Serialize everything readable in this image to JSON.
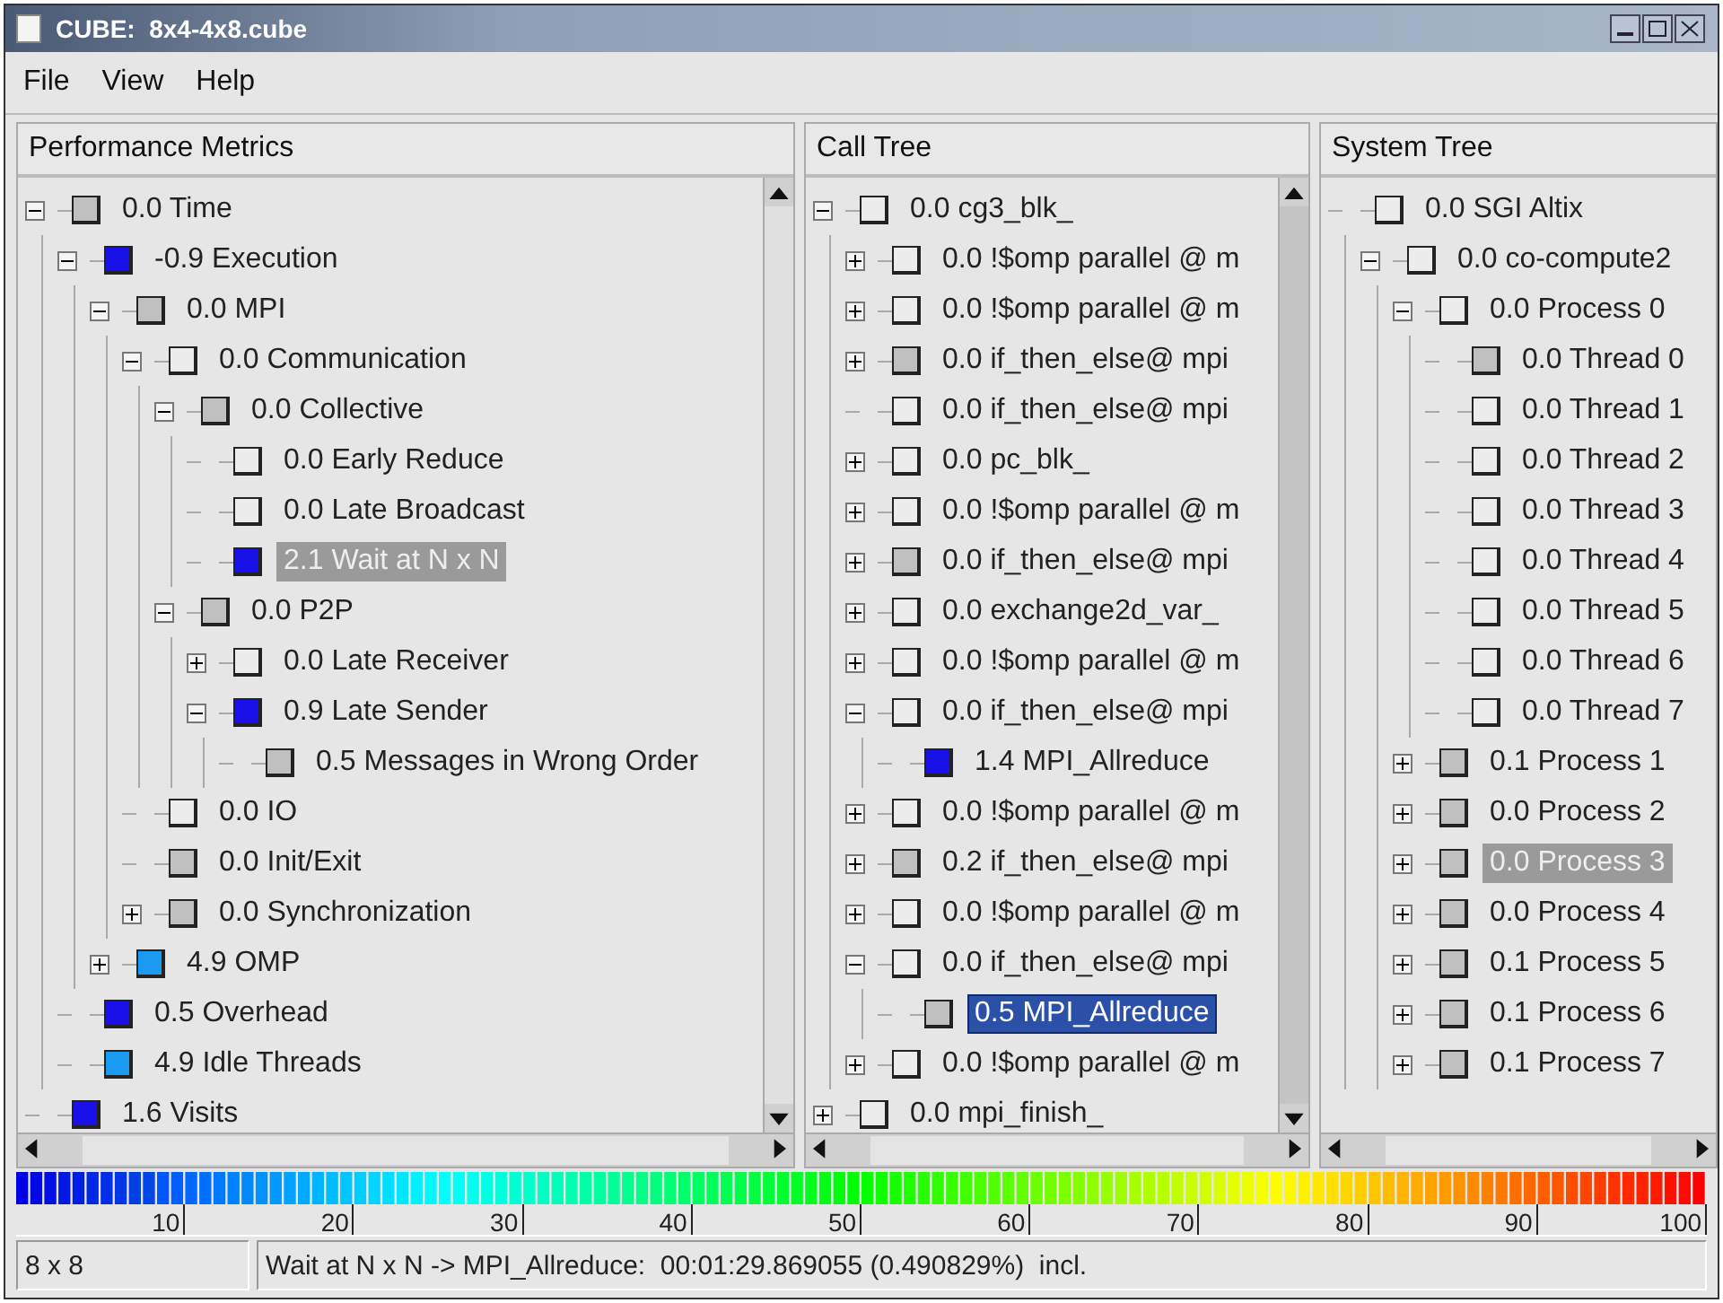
{
  "window": {
    "title": "CUBE:  8x4-4x8.cube"
  },
  "menu": [
    "File",
    "View",
    "Help"
  ],
  "panels": [
    {
      "title": "Performance Metrics",
      "focused": false,
      "items": [
        {
          "label": "0.0 Time",
          "color": "#c0c0c0",
          "expanded": true,
          "selected": false,
          "children": [
            {
              "label": "-0.9 Execution",
              "color": "#1a10e8",
              "expanded": true,
              "selected": false,
              "children": [
                {
                  "label": "0.0 MPI",
                  "color": "#c0c0c0",
                  "expanded": true,
                  "selected": false,
                  "children": [
                    {
                      "label": "0.0 Communication",
                      "color": "#ececec",
                      "expanded": true,
                      "selected": false,
                      "children": [
                        {
                          "label": "0.0 Collective",
                          "color": "#c0c0c0",
                          "expanded": true,
                          "selected": false,
                          "children": [
                            {
                              "label": "0.0 Early Reduce",
                              "color": "#ececec",
                              "selected": false
                            },
                            {
                              "label": "0.0 Late Broadcast",
                              "color": "#ececec",
                              "selected": false
                            },
                            {
                              "label": "2.1 Wait at N x N",
                              "color": "#1a10e8",
                              "selected": true
                            }
                          ]
                        },
                        {
                          "label": "0.0 P2P",
                          "color": "#c0c0c0",
                          "expanded": true,
                          "selected": false,
                          "children": [
                            {
                              "label": "0.0 Late Receiver",
                              "color": "#ececec",
                              "expanded": false,
                              "selected": false
                            },
                            {
                              "label": "0.9 Late Sender",
                              "color": "#1a10e8",
                              "expanded": true,
                              "selected": false,
                              "children": [
                                {
                                  "label": "0.5 Messages in Wrong Order",
                                  "color": "#c0c0c0",
                                  "selected": false
                                }
                              ]
                            }
                          ]
                        }
                      ]
                    },
                    {
                      "label": "0.0 IO",
                      "color": "#ececec",
                      "selected": false
                    },
                    {
                      "label": "0.0 Init/Exit",
                      "color": "#c0c0c0",
                      "selected": false
                    },
                    {
                      "label": "0.0 Synchronization",
                      "color": "#c0c0c0",
                      "expanded": false,
                      "selected": false
                    }
                  ]
                },
                {
                  "label": "4.9 OMP",
                  "color": "#1a9af0",
                  "expanded": false,
                  "selected": false
                }
              ]
            },
            {
              "label": "0.5 Overhead",
              "color": "#1a10e8",
              "selected": false
            },
            {
              "label": "4.9 Idle Threads",
              "color": "#1a9af0",
              "selected": false
            }
          ]
        },
        {
          "label": "1.6 Visits",
          "color": "#1a10e8",
          "selected": false
        }
      ]
    },
    {
      "title": "Call Tree",
      "focused": true,
      "items": [
        {
          "label": "0.0 cg3_blk_",
          "color": "#ececec",
          "expanded": true,
          "selected": false,
          "children": [
            {
              "label": "0.0 !$omp parallel @ m",
              "color": "#ececec",
              "expanded": false,
              "selected": false
            },
            {
              "label": "0.0 !$omp parallel @ m",
              "color": "#ececec",
              "expanded": false,
              "selected": false
            },
            {
              "label": "0.0 if_then_else@ mpi",
              "color": "#c0c0c0",
              "expanded": false,
              "selected": false
            },
            {
              "label": "0.0 if_then_else@ mpi",
              "color": "#ececec",
              "selected": false
            },
            {
              "label": "0.0 pc_blk_",
              "color": "#ececec",
              "expanded": false,
              "selected": false
            },
            {
              "label": "0.0 !$omp parallel @ m",
              "color": "#ececec",
              "expanded": false,
              "selected": false
            },
            {
              "label": "0.0 if_then_else@ mpi",
              "color": "#c0c0c0",
              "expanded": false,
              "selected": false
            },
            {
              "label": "0.0 exchange2d_var_",
              "color": "#ececec",
              "expanded": false,
              "selected": false
            },
            {
              "label": "0.0 !$omp parallel @ m",
              "color": "#ececec",
              "expanded": false,
              "selected": false
            },
            {
              "label": "0.0 if_then_else@ mpi",
              "color": "#ececec",
              "expanded": true,
              "selected": false,
              "children": [
                {
                  "label": "1.4 MPI_Allreduce",
                  "color": "#1a10e8",
                  "selected": false
                }
              ]
            },
            {
              "label": "0.0 !$omp parallel @ m",
              "color": "#ececec",
              "expanded": false,
              "selected": false
            },
            {
              "label": "0.2 if_then_else@ mpi",
              "color": "#c0c0c0",
              "expanded": false,
              "selected": false
            },
            {
              "label": "0.0 !$omp parallel @ m",
              "color": "#ececec",
              "expanded": false,
              "selected": false
            },
            {
              "label": "0.0 if_then_else@ mpi",
              "color": "#ececec",
              "expanded": true,
              "selected": false,
              "children": [
                {
                  "label": "0.5 MPI_Allreduce",
                  "color": "#c0c0c0",
                  "selected": true
                }
              ]
            },
            {
              "label": "0.0 !$omp parallel @ m",
              "color": "#ececec",
              "expanded": false,
              "selected": false
            }
          ]
        },
        {
          "label": "0.0 mpi_finish_",
          "color": "#ececec",
          "expanded": false,
          "selected": false
        }
      ]
    },
    {
      "title": "System Tree",
      "focused": false,
      "items": [
        {
          "label": "0.0 SGI Altix",
          "color": "#ececec",
          "selected": false,
          "children": [
            {
              "label": "0.0 co-compute2",
              "color": "#ececec",
              "expanded": true,
              "selected": false,
              "children": [
                {
                  "label": "0.0 Process 0",
                  "color": "#ececec",
                  "expanded": true,
                  "selected": false,
                  "children": [
                    {
                      "label": "0.0 Thread 0",
                      "color": "#c0c0c0",
                      "selected": false
                    },
                    {
                      "label": "0.0 Thread 1",
                      "color": "#ececec",
                      "selected": false
                    },
                    {
                      "label": "0.0 Thread 2",
                      "color": "#ececec",
                      "selected": false
                    },
                    {
                      "label": "0.0 Thread 3",
                      "color": "#ececec",
                      "selected": false
                    },
                    {
                      "label": "0.0 Thread 4",
                      "color": "#ececec",
                      "selected": false
                    },
                    {
                      "label": "0.0 Thread 5",
                      "color": "#ececec",
                      "selected": false
                    },
                    {
                      "label": "0.0 Thread 6",
                      "color": "#ececec",
                      "selected": false
                    },
                    {
                      "label": "0.0 Thread 7",
                      "color": "#ececec",
                      "selected": false
                    }
                  ]
                },
                {
                  "label": "0.1 Process 1",
                  "color": "#c0c0c0",
                  "expanded": false,
                  "selected": false
                },
                {
                  "label": "0.0 Process 2",
                  "color": "#c0c0c0",
                  "expanded": false,
                  "selected": false
                },
                {
                  "label": "0.0 Process 3",
                  "color": "#c0c0c0",
                  "expanded": false,
                  "selected": true
                },
                {
                  "label": "0.0 Process 4",
                  "color": "#c0c0c0",
                  "expanded": false,
                  "selected": false
                },
                {
                  "label": "0.1 Process 5",
                  "color": "#c0c0c0",
                  "expanded": false,
                  "selected": false
                },
                {
                  "label": "0.1 Process 6",
                  "color": "#c0c0c0",
                  "expanded": false,
                  "selected": false
                },
                {
                  "label": "0.1 Process 7",
                  "color": "#c0c0c0",
                  "expanded": false,
                  "selected": false
                }
              ]
            }
          ]
        }
      ]
    }
  ],
  "color_scale": {
    "ticks": [
      "10",
      "20",
      "30",
      "40",
      "50",
      "60",
      "70",
      "80",
      "90",
      "100"
    ]
  },
  "status_bar": {
    "dimensions": "8 x 8",
    "message": "Wait at N x N -> MPI_Allreduce:  00:01:29.869055 (0.490829%)  incl."
  }
}
